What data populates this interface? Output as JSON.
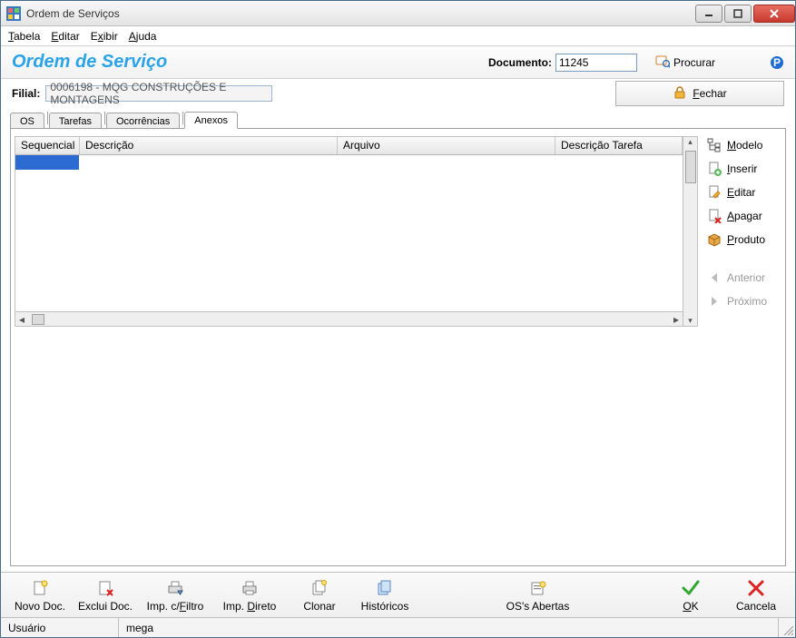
{
  "window": {
    "title": "Ordem de Serviços"
  },
  "menubar": {
    "tabela": "Tabela",
    "editar": "Editar",
    "exibir": "Exibir",
    "ajuda": "Ajuda"
  },
  "header": {
    "module_title": "Ordem de Serviço",
    "documento_label": "Documento:",
    "documento_value": "11245",
    "procurar_label": "Procurar"
  },
  "filial": {
    "label": "Filial:",
    "value": "0006198 - MQG CONSTRUÇÕES E MONTAGENS",
    "fechar_label": "Fechar"
  },
  "tabs": {
    "os": "OS",
    "tarefas": "Tarefas",
    "ocorrencias": "Ocorrências",
    "anexos": "Anexos"
  },
  "grid": {
    "columns": {
      "sequencial": "Sequencial",
      "descricao": "Descrição",
      "arquivo": "Arquivo",
      "descricao_tarefa": "Descrição Tarefa"
    },
    "rows": []
  },
  "side": {
    "modelo": "Modelo",
    "inserir": "Inserir",
    "editar": "Editar",
    "apagar": "Apagar",
    "produto": "Produto",
    "anterior": "Anterior",
    "proximo": "Próximo"
  },
  "toolbar": {
    "novo_doc": "Novo Doc.",
    "exclui_doc": "Exclui Doc.",
    "imp_cfiltro": "Imp. c/Filtro",
    "imp_direto": "Imp. Direto",
    "clonar": "Clonar",
    "historicos": "Históricos",
    "oss_abertas": "OS's Abertas",
    "ok": "OK",
    "cancela": "Cancela"
  },
  "status": {
    "usuario_label": "Usuário",
    "usuario_value": "mega"
  }
}
